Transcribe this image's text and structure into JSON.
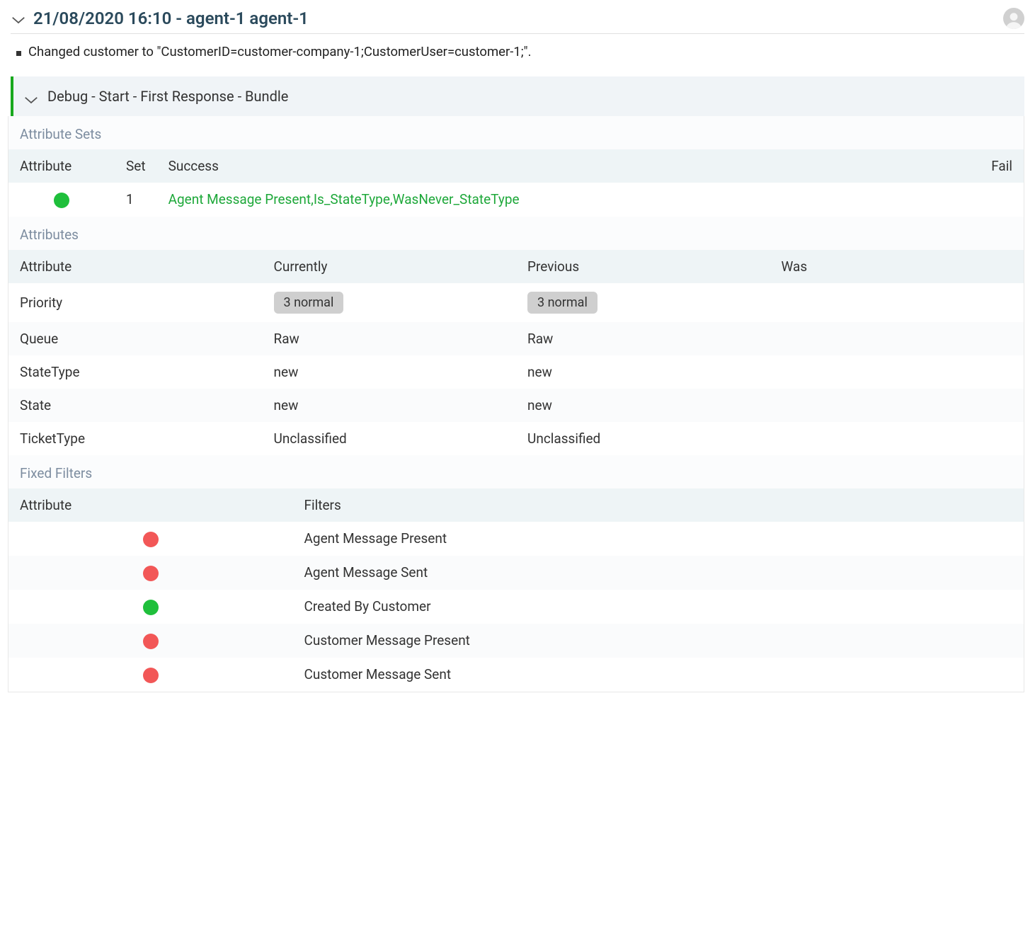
{
  "header": {
    "title": "21/08/2020 16:10 - agent-1 agent-1"
  },
  "changes": [
    "Changed customer to \"CustomerID=customer-company-1;CustomerUser=customer-1;\"."
  ],
  "debug": {
    "title": "Debug - Start - First Response - Bundle",
    "attribute_sets": {
      "section_label": "Attribute Sets",
      "headers": {
        "attribute": "Attribute",
        "set": "Set",
        "success": "Success",
        "fail": "Fail"
      },
      "rows": [
        {
          "status": "green",
          "set": "1",
          "success": "Agent Message Present,Is_StateType,WasNever_StateType",
          "fail": ""
        }
      ]
    },
    "attributes": {
      "section_label": "Attributes",
      "headers": {
        "attribute": "Attribute",
        "currently": "Currently",
        "previous": "Previous",
        "was": "Was"
      },
      "rows": [
        {
          "attribute": "Priority",
          "currently": "3 normal",
          "previous": "3 normal",
          "was": "",
          "tag": true
        },
        {
          "attribute": "Queue",
          "currently": "Raw",
          "previous": "Raw",
          "was": "",
          "tag": false
        },
        {
          "attribute": "StateType",
          "currently": "new",
          "previous": "new",
          "was": "",
          "tag": false
        },
        {
          "attribute": "State",
          "currently": "new",
          "previous": "new",
          "was": "",
          "tag": false
        },
        {
          "attribute": "TicketType",
          "currently": "Unclassified",
          "previous": "Unclassified",
          "was": "",
          "tag": false
        }
      ]
    },
    "fixed_filters": {
      "section_label": "Fixed Filters",
      "headers": {
        "attribute": "Attribute",
        "filters": "Filters"
      },
      "rows": [
        {
          "status": "red",
          "filter": "Agent Message Present"
        },
        {
          "status": "red",
          "filter": "Agent Message Sent"
        },
        {
          "status": "green",
          "filter": "Created By Customer"
        },
        {
          "status": "red",
          "filter": "Customer Message Present"
        },
        {
          "status": "red",
          "filter": "Customer Message Sent"
        }
      ]
    }
  }
}
